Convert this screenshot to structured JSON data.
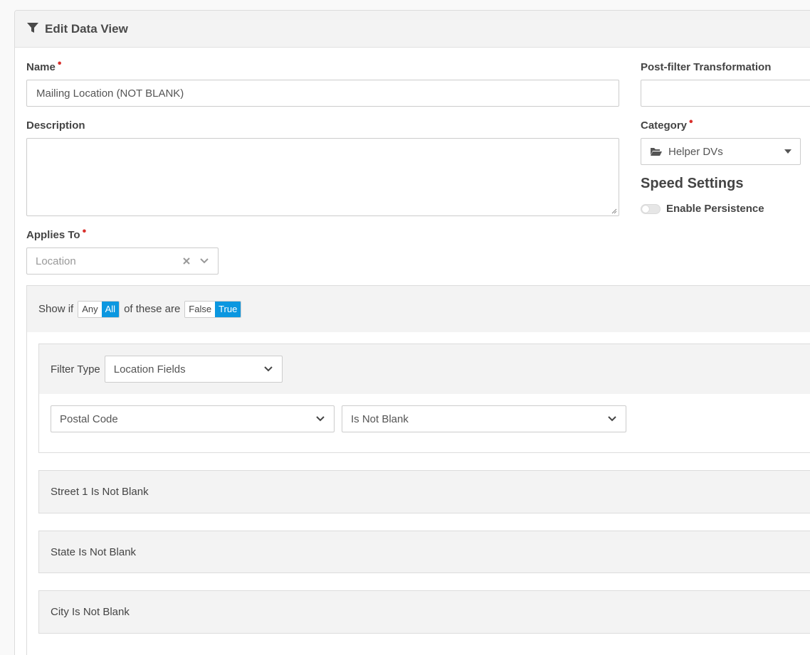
{
  "panel": {
    "title": "Edit Data View"
  },
  "form": {
    "name_label": "Name",
    "name_value": "Mailing Location (NOT BLANK)",
    "description_label": "Description",
    "description_value": "",
    "applies_to_label": "Applies To",
    "applies_to_value": "Location",
    "post_filter_label": "Post-filter Transformation",
    "post_filter_value": "",
    "category_label": "Category",
    "category_value": "Helper DVs",
    "speed_settings_heading": "Speed Settings",
    "enable_persistence_label": "Enable Persistence",
    "enable_persistence_on": false
  },
  "filter": {
    "show_if": "Show if",
    "any": "Any",
    "all": "All",
    "of_these_are": "of these are",
    "false_label": "False",
    "true_label": "True",
    "selected_quantifier": "All",
    "selected_truth": "True",
    "filter_type_label": "Filter Type",
    "filter_type_value": "Location Fields",
    "field_value": "Postal Code",
    "comparison_value": "Is Not Blank",
    "collapsed_filters": [
      "Street 1 Is Not Blank",
      "State Is Not Blank",
      "City Is Not Blank"
    ]
  },
  "colors": {
    "accent": "#0b97e0",
    "required": "#d9302c"
  },
  "icons": [
    "filter-icon",
    "folder-open-icon",
    "caret-down-icon",
    "clear-x-icon",
    "chevron-down-icon"
  ]
}
